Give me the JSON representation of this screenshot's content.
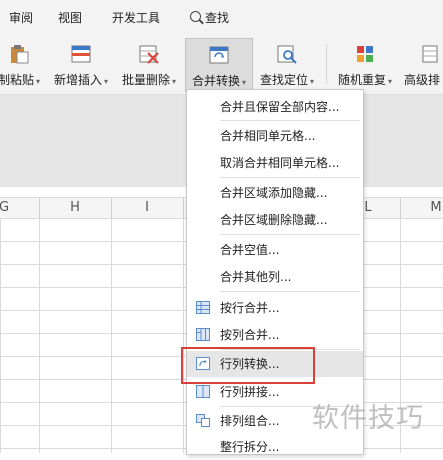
{
  "menubar": {
    "review": "审阅",
    "view": "视图",
    "dev_tools": "开发工具",
    "search": "查找"
  },
  "ribbon": {
    "paste_values": "制粘贴",
    "add_insert": "新增插入",
    "batch_delete": "批量删除",
    "merge_convert": "合并转换",
    "find_locate": "查找定位",
    "random_repeat": "随机重复",
    "advanced_sort": "高级排"
  },
  "columns": [
    "G",
    "H",
    "I",
    "L",
    "M"
  ],
  "dropdown": {
    "items": [
      "合并且保留全部内容...",
      "合并相同单元格...",
      "取消合并相同单元格...",
      "合并区域添加隐藏...",
      "合并区域删除隐藏...",
      "合并空值...",
      "合并其他列...",
      "按行合并...",
      "按列合并...",
      "行列转换...",
      "行列拼接...",
      "排列组合...",
      "整行拆分..."
    ],
    "highlighted": "行列转换..."
  },
  "colors": {
    "highlight_box": "#d9403a",
    "hover": "#e6e6e6"
  },
  "watermark": "软件技巧"
}
